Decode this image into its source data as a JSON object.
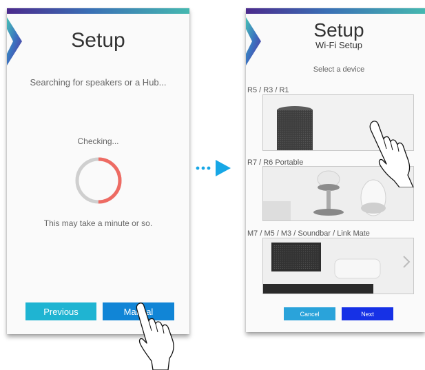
{
  "screen_left": {
    "title": "Setup",
    "status_text": "Searching for speakers or a Hub...",
    "checking_text": "Checking...",
    "wait_text": "This may take a minute or so.",
    "spinner_progress": 0.5,
    "previous_label": "Previous",
    "manual_label": "Manual"
  },
  "screen_right": {
    "title": "Setup",
    "subtitle": "Wi-Fi Setup",
    "prompt": "Select a device",
    "devices": [
      {
        "label": "R5 / R3 / R1"
      },
      {
        "label": "R7 / R6 Portable"
      },
      {
        "label": "M7 / M5 / M3 / Soundbar / Link Mate"
      }
    ],
    "cancel_label": "Cancel",
    "next_label": "Next"
  },
  "colors": {
    "accent_cyan": "#1fb4d2",
    "accent_blue": "#1185d6",
    "next_blue": "#1631e6",
    "cancel_blue": "#2aa3da",
    "spinner_red": "#ee6b63",
    "spinner_gray": "#cfcfcf",
    "arrow_blue": "#17a7e6"
  },
  "icons": [
    "brand-logo-icon",
    "dotted-arrow-icon",
    "hand-pointer-icon"
  ]
}
